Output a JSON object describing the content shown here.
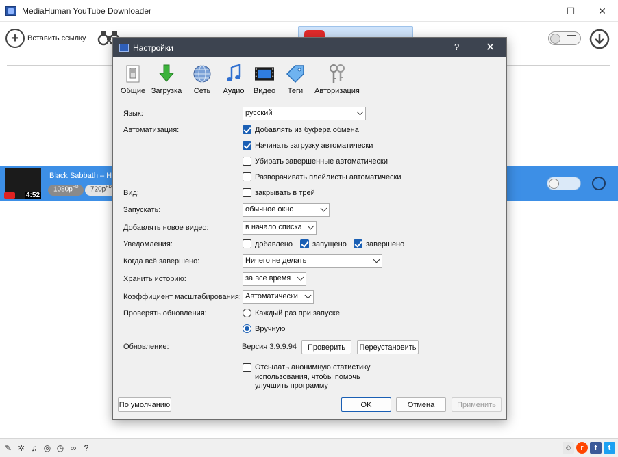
{
  "app": {
    "title": "MediaHuman YouTube Downloader",
    "window_controls": {
      "minimize": "—",
      "maximize": "☐",
      "close": "✕"
    }
  },
  "toolbar": {
    "paste_link_label": "Вставить ссылку"
  },
  "download_item": {
    "title": "Black Sabbath – He",
    "duration": "4:52",
    "quality_1": "1080p",
    "quality_1_badge": "HD",
    "quality_2": "720p",
    "quality_2_badge": "HD"
  },
  "dialog": {
    "title": "Настройки",
    "help": "?",
    "close": "✕",
    "tabs": [
      {
        "label": "Общие",
        "icon": "switch-icon"
      },
      {
        "label": "Загрузка",
        "icon": "download-arrow-icon"
      },
      {
        "label": "Сеть",
        "icon": "globe-icon"
      },
      {
        "label": "Аудио",
        "icon": "music-note-icon"
      },
      {
        "label": "Видео",
        "icon": "film-icon"
      },
      {
        "label": "Теги",
        "icon": "tag-icon"
      },
      {
        "label": "Авторизация",
        "icon": "keys-icon"
      }
    ],
    "language": {
      "label": "Язык:",
      "value": "русский"
    },
    "automation": {
      "label": "Автоматизация:",
      "options": [
        {
          "label": "Добавлять из буфера обмена",
          "checked": true
        },
        {
          "label": "Начинать загрузку автоматически",
          "checked": true
        },
        {
          "label": "Убирать завершенные автоматически",
          "checked": false
        },
        {
          "label": "Разворачивать плейлисты автоматически",
          "checked": false
        }
      ]
    },
    "view": {
      "label": "Вид:",
      "option": "закрывать в трей",
      "checked": false
    },
    "launch": {
      "label": "Запускать:",
      "value": "обычное окно"
    },
    "add_new": {
      "label": "Добавлять новое видео:",
      "value": "в начало списка"
    },
    "notifications": {
      "label": "Уведомления:",
      "options": [
        {
          "label": "добавлено",
          "checked": false
        },
        {
          "label": "запущено",
          "checked": true
        },
        {
          "label": "завершено",
          "checked": true
        }
      ]
    },
    "when_done": {
      "label": "Когда всё завершено:",
      "value": "Ничего не делать"
    },
    "history": {
      "label": "Хранить историю:",
      "value": "за все время"
    },
    "zoom": {
      "label": "Коэффициент масштабирования:",
      "value": "Автоматически"
    },
    "updates": {
      "label": "Проверять обновления:",
      "options": [
        {
          "label": "Каждый раз при запуске",
          "selected": false
        },
        {
          "label": "Вручную",
          "selected": true
        }
      ]
    },
    "update": {
      "label": "Обновление:",
      "version": "Версия 3.9.9.94",
      "check_button": "Проверить",
      "reinstall_button": "Переустановить"
    },
    "stats": {
      "line1": "Отсылать анонимную статистику",
      "line2": "использования, чтобы помочь",
      "line3": "улучшить программу",
      "checked": false
    },
    "buttons": {
      "defaults": "По умолчанию",
      "ok": "OK",
      "cancel": "Отмена",
      "apply": "Применить"
    }
  }
}
